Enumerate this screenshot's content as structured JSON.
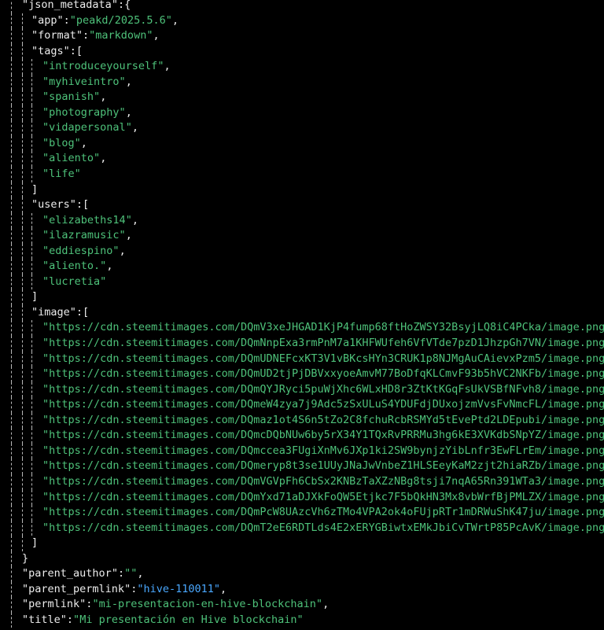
{
  "colors": {
    "background": "#000000",
    "punctuation": "#ececec",
    "string_value": "#4ec27a",
    "link_value": "#4aa8ff",
    "indent_guide": "#b8b8b8"
  },
  "json_metadata": {
    "key": "json_metadata",
    "app": "peakd/2025.5.6",
    "format": "markdown",
    "tags": [
      "introduceyourself",
      "myhiveintro",
      "spanish",
      "photography",
      "vidapersonal",
      "blog",
      "aliento",
      "life"
    ],
    "users": [
      "elizabeths14",
      "ilazramusic",
      "eddiespino",
      "aliento.",
      "lucretia"
    ],
    "image": [
      "https://cdn.steemitimages.com/DQmV3xeJHGAD1KjP4fump68ftHoZWSY32BsyjLQ8iC4PCka/image.png",
      "https://cdn.steemitimages.com/DQmNnpExa3rmPnM7a1KHFWUfeh6VfVTde7pzD1JhzpGh7VN/image.png",
      "https://cdn.steemitimages.com/DQmUDNEFcxKT3V1vBKcsHYn3CRUK1p8NJMgAuCAievxPzm5/image.png",
      "https://cdn.steemitimages.com/DQmUD2tjPjDBVxxyoeAmvM77BoDfqKLCmvF93b5hVC2NKFb/image.png",
      "https://cdn.steemitimages.com/DQmQYJRyci5puWjXhc6WLxHD8r3ZtKtKGqFsUkVSBfNFvh8/image.png",
      "https://cdn.steemitimages.com/DQmeW4zya7j9Adc5zSxULuS4YDUFdjDUxojzmVvsFvNmcFL/image.png",
      "https://cdn.steemitimages.com/DQmaz1ot4S6n5tZo2C8fchuRcbRSMYd5tEvePtd2LDEpubi/image.png",
      "https://cdn.steemitimages.com/DQmcDQbNUw6by5rX34Y1TQxRvPRRMu3hg6kE3XVKdbSNpYZ/image.png",
      "https://cdn.steemitimages.com/DQmccea3FUgiXnMv6JXp1ki2SW9bynjzYibLnfr3EwFLrEm/image.png",
      "https://cdn.steemitimages.com/DQmeryp8t3se1UUyJNaJwVnbeZ1HLSEeyKaM2zjt2hiaRZb/image.png",
      "https://cdn.steemitimages.com/DQmVGVpFh6CbSx2KNBzTaXZzNBg8tsji7nqA65Rn391WTa3/image.png",
      "https://cdn.steemitimages.com/DQmYxd71aDJXkFoQW5Etjkc7F5bQkHN3Mx8vbWrfBjPMLZX/image.png",
      "https://cdn.steemitimages.com/DQmPcW8UAzcVh6zTMo4VPA2ok4oFUjpRTr1mDRWuShK47ju/image.png",
      "https://cdn.steemitimages.com/DQmT2eE6RDTLds4E2xERYGBiwtxEMkJbiCvTWrtP85PcAvK/image.png"
    ]
  },
  "root_fields": {
    "parent_author_key": "parent_author",
    "parent_author": "",
    "parent_permlink_key": "parent_permlink",
    "parent_permlink": "hive-110011",
    "permlink_key": "permlink",
    "permlink": "mi-presentacion-en-hive-blockchain",
    "title_key": "title",
    "title": "Mi presentación en Hive blockchain"
  }
}
